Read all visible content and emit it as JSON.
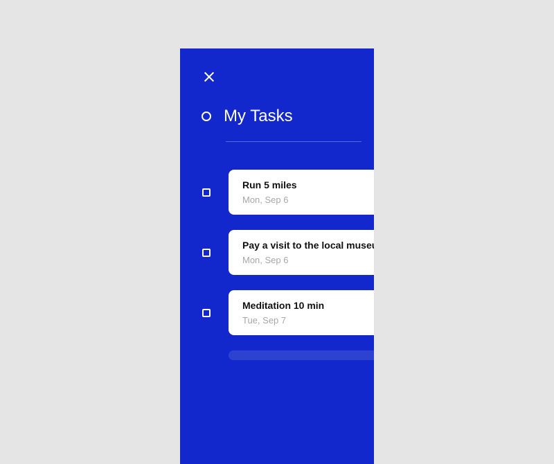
{
  "title": "My Tasks",
  "tasks": [
    {
      "title": "Run 5 miles",
      "date": "Mon, Sep 6"
    },
    {
      "title": "Pay a visit to the local museum",
      "date": "Mon, Sep 6"
    },
    {
      "title": "Meditation 10 min",
      "date": "Tue, Sep 7"
    }
  ]
}
